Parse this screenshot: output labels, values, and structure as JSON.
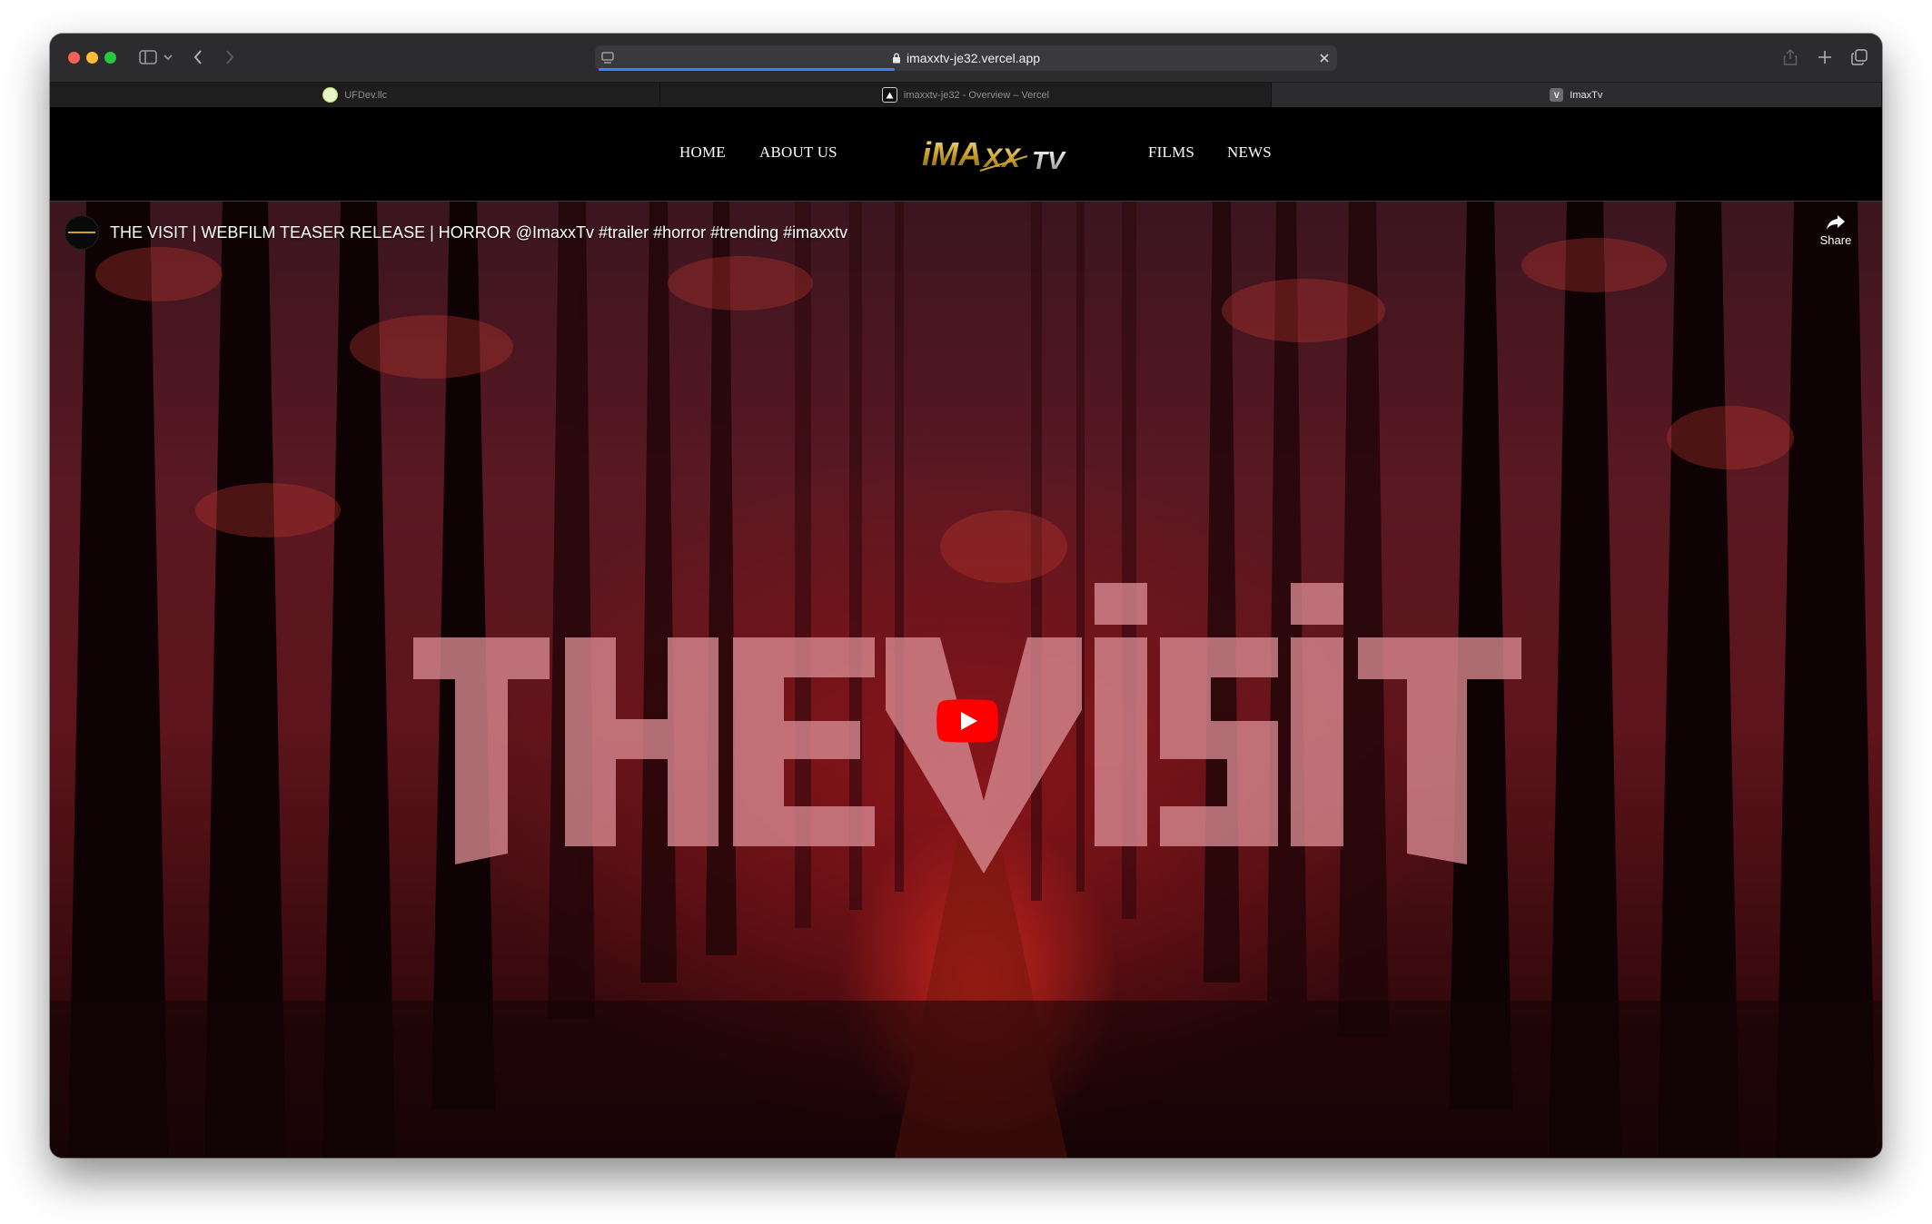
{
  "browser": {
    "url": "imaxxtv-je32.vercel.app",
    "tabs": [
      {
        "label": "UFDev.llc",
        "active": false,
        "favicon": "green-circle"
      },
      {
        "label": "imaxxtv-je32 - Overview – Vercel",
        "active": false,
        "favicon": "vercel-triangle"
      },
      {
        "label": "ImaxTv",
        "active": true,
        "favicon": "V"
      }
    ]
  },
  "site": {
    "nav_left": [
      "HOME",
      "ABOUT US"
    ],
    "nav_right": [
      "FILMS",
      "NEWS"
    ],
    "logo_text": "iMAXX TV"
  },
  "video": {
    "title": "THE VISIT | WEBFILM TEASER RELEASE | HORROR @ImaxxTv #trailer #horror #trending #imaxxtv",
    "share_label": "Share",
    "overlay_title": "THE VISIT"
  },
  "colors": {
    "accent_red": "#ff0000",
    "logo_gold": "#c9a227",
    "window_chrome": "#2c2c2e"
  }
}
